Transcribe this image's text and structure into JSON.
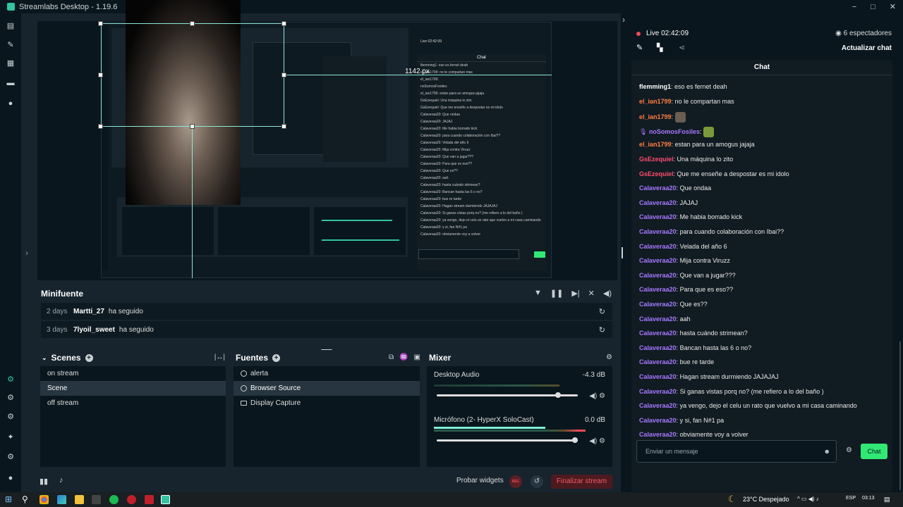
{
  "app": {
    "title": "Streamlabs Desktop - 1.19.6",
    "window_controls": [
      "−",
      "□",
      "✕"
    ]
  },
  "live": {
    "status": "Live 02:42:09",
    "viewers": "6 espectadores",
    "update_chat": "Actualizar chat"
  },
  "preview": {
    "size_label": "1142 px"
  },
  "minifuente": {
    "title": "Minifuente",
    "events": [
      {
        "ago": "2 days",
        "user": "Martti_27",
        "action": "ha seguido"
      },
      {
        "ago": "3 days",
        "user": "7lyoil_sweet",
        "action": "ha seguido"
      }
    ]
  },
  "scenes": {
    "title": "Scenes",
    "items": [
      "on stream",
      "Scene",
      "off stream"
    ],
    "selected": "Scene"
  },
  "sources": {
    "title": "Fuentes",
    "items": [
      "alerta",
      "Browser Source",
      "Display Capture"
    ],
    "selected": "Browser Source"
  },
  "mixer": {
    "title": "Mixer",
    "channels": [
      {
        "name": "Desktop Audio",
        "db": "-4.3 dB",
        "volume_fraction": 0.86
      },
      {
        "name": "Micrófono (2- HyperX SoloCast)",
        "db": "0.0 dB",
        "volume_fraction": 0.98
      }
    ]
  },
  "footer": {
    "test_widgets": "Probar widgets",
    "rec": "REC",
    "end_stream": "Finalizar stream"
  },
  "chat": {
    "title": "Chat",
    "input_placeholder": "Enviar un mensaje",
    "send": "Chat",
    "messages": [
      {
        "user": "flemming1",
        "text": "eso es fernet deah",
        "color": "#ffffff"
      },
      {
        "user": "el_ian1799",
        "text": "no le compartan mas",
        "color": "#ff7f3f"
      },
      {
        "user": "el_ian1799",
        "text": "",
        "color": "#ff7f3f",
        "emote": "face"
      },
      {
        "user": "noSomosFosiles",
        "text": "",
        "color": "#a679ff",
        "emote": "frog",
        "badge": true
      },
      {
        "user": "el_ian1799",
        "text": "estan para un amogus jajaja",
        "color": "#ff7f3f"
      },
      {
        "user": "GsEzequiel",
        "text": "Una máquina lo zito",
        "color": "#ff4d6d"
      },
      {
        "user": "GsEzequiel",
        "text": "Que me enseñe a despostar es mi idolo",
        "color": "#ff4d6d"
      },
      {
        "user": "Calaveraa20",
        "text": "Que ondaa",
        "color": "#a679ff"
      },
      {
        "user": "Calaveraa20",
        "text": "JAJAJ",
        "color": "#a679ff"
      },
      {
        "user": "Calaveraa20",
        "text": "Me habia borrado kick",
        "color": "#a679ff"
      },
      {
        "user": "Calaveraa20",
        "text": "para cuando colaboración con Ibai??",
        "color": "#a679ff"
      },
      {
        "user": "Calaveraa20",
        "text": "Velada del año 6",
        "color": "#a679ff"
      },
      {
        "user": "Calaveraa20",
        "text": "Mija contra Viruzz",
        "color": "#a679ff"
      },
      {
        "user": "Calaveraa20",
        "text": "Que van a jugar???",
        "color": "#a679ff"
      },
      {
        "user": "Calaveraa20",
        "text": "Para que es eso??",
        "color": "#a679ff"
      },
      {
        "user": "Calaveraa20",
        "text": "Que es??",
        "color": "#a679ff"
      },
      {
        "user": "Calaveraa20",
        "text": "aah",
        "color": "#a679ff"
      },
      {
        "user": "Calaveraa20",
        "text": "hasta cuándo strimean?",
        "color": "#a679ff"
      },
      {
        "user": "Calaveraa20",
        "text": "Bancan hasta las 6 o no?",
        "color": "#a679ff"
      },
      {
        "user": "Calaveraa20",
        "text": "bue re tarde",
        "color": "#a679ff"
      },
      {
        "user": "Calaveraa20",
        "text": "Hagan stream durmiendo JAJAJAJ",
        "color": "#a679ff"
      },
      {
        "user": "Calaveraa20",
        "text": "Si ganas vistas porq no? (me refiero a lo del baño )",
        "color": "#a679ff"
      },
      {
        "user": "Calaveraa20",
        "text": "ya vengo, dejo el celu un rato que vuelvo a mi casa caminando",
        "color": "#a679ff"
      },
      {
        "user": "Calaveraa20",
        "text": "y si, fan N#1 pa",
        "color": "#a679ff"
      },
      {
        "user": "Calaveraa20",
        "text": "obviamente voy a volver",
        "color": "#a679ff"
      }
    ]
  },
  "taskbar": {
    "weather": "23°C  Despejado",
    "lang": "ESP",
    "time": "03:13"
  },
  "nested": {
    "live": "Live 02:42:09",
    "chat": "Chat",
    "lines": [
      "flemming1: eso es fernet deah",
      "el_ian1799: no le compartan mas",
      "el_ian1799:",
      "noSomosFosiles:",
      "el_ian1799: estan para un amogus jajaja",
      "GsEzequiel: Una máquina lo zito",
      "GsEzequiel: Que me enseñe a despostar es mi idolo",
      "Calaveraa20: Que ondaa",
      "Calaveraa20: JAJAJ",
      "Calaveraa20: Me habia borrado kick",
      "Calaveraa20: para cuando colaboración con Ibai??",
      "Calaveraa20: Velada del año 6",
      "Calaveraa20: Mija contra Viruzz",
      "Calaveraa20: Que van a jugar???",
      "Calaveraa20: Para que es eso??",
      "Calaveraa20: Que es??",
      "Calaveraa20: aah",
      "Calaveraa20: hasta cuándo strimean?",
      "Calaveraa20: Bancan hasta las 6 o no?",
      "Calaveraa20: bue re tarde",
      "Calaveraa20: Hagan stream durmiendo JAJAJAJ",
      "Calaveraa20: Si ganas vistas porq no? (me refiero a lo del baño )",
      "Calaveraa20: ya vengo, dejo el celu un rato que vuelvo a mi casa caminando",
      "Calaveraa20: y si, fan N#1 pa",
      "Calaveraa20: obviamente voy a volver"
    ]
  }
}
